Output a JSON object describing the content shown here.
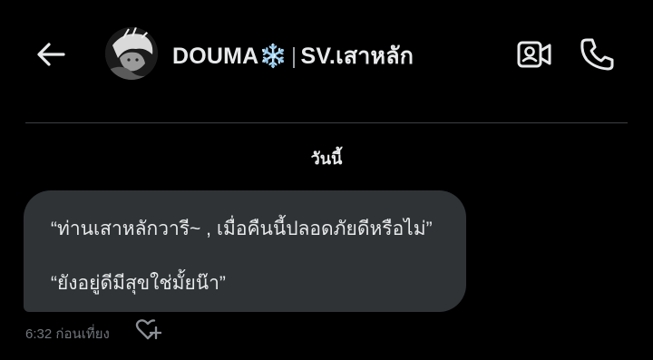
{
  "header": {
    "name": "DOUMA",
    "name_emoji": "❄️",
    "separator": "|",
    "handle": "SV.เสาหลัก"
  },
  "date_separator": "วันนี้",
  "message": {
    "line1": "“ท่านเสาหลักวารี~ , เมื่อคืนนี้ปลอดภัยดีหรือไม่”",
    "line2": "“ยังอยู่ดีมีสุขใช่มั้ยน๊า”",
    "time": "6:32 ก่อนเที่ยง"
  },
  "icons": {
    "back": "arrow-left-icon",
    "video": "video-camera-icon",
    "call": "phone-icon",
    "react": "heart-plus-icon"
  },
  "colors": {
    "background": "#000000",
    "bubble": "#2f3336",
    "text": "#e7e9ea",
    "muted": "#71767b"
  }
}
